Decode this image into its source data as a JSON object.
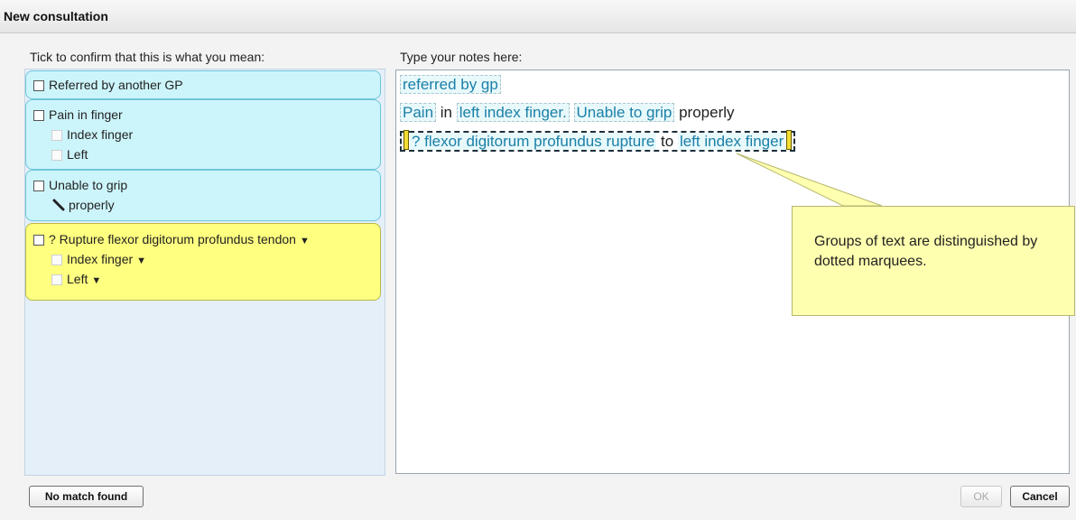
{
  "window": {
    "title": "New consultation"
  },
  "left_panel": {
    "label": "Tick to confirm that this is what you mean:",
    "groups": [
      {
        "title": "Referred by another GP",
        "subitems": []
      },
      {
        "title": "Pain in finger",
        "subitems": [
          "Index finger",
          "Left"
        ]
      },
      {
        "title": "Unable to grip",
        "subitems": [
          "properly"
        ]
      },
      {
        "title": "? Rupture flexor digitorum profundus tendon",
        "subitems": [
          "Index finger",
          "Left"
        ],
        "highlight": "#ffff80"
      }
    ],
    "colors": {
      "group_bg": "#ccf5fb",
      "highlight_bg": "#ffff80",
      "panel_bg": "#e4effa"
    }
  },
  "notes": {
    "label": "Type your notes here:",
    "line1": {
      "t1": "referred by gp"
    },
    "line2": {
      "t1": "Pain",
      "t2": " in ",
      "t3": "left index finger.",
      "t4": "Unable to grip",
      "t5": " properly"
    },
    "line3": {
      "t1": "? flexor digitorum profundus rupture",
      "t2": " to ",
      "t3": "left index finger"
    }
  },
  "callout": {
    "text": "Groups of text are distinguished by dotted marquees."
  },
  "buttons": {
    "no_match": "No match found",
    "ok": "OK",
    "cancel": "Cancel"
  },
  "icons": {
    "dropdown": "triangle-down-icon",
    "pen": "pen-icon"
  }
}
